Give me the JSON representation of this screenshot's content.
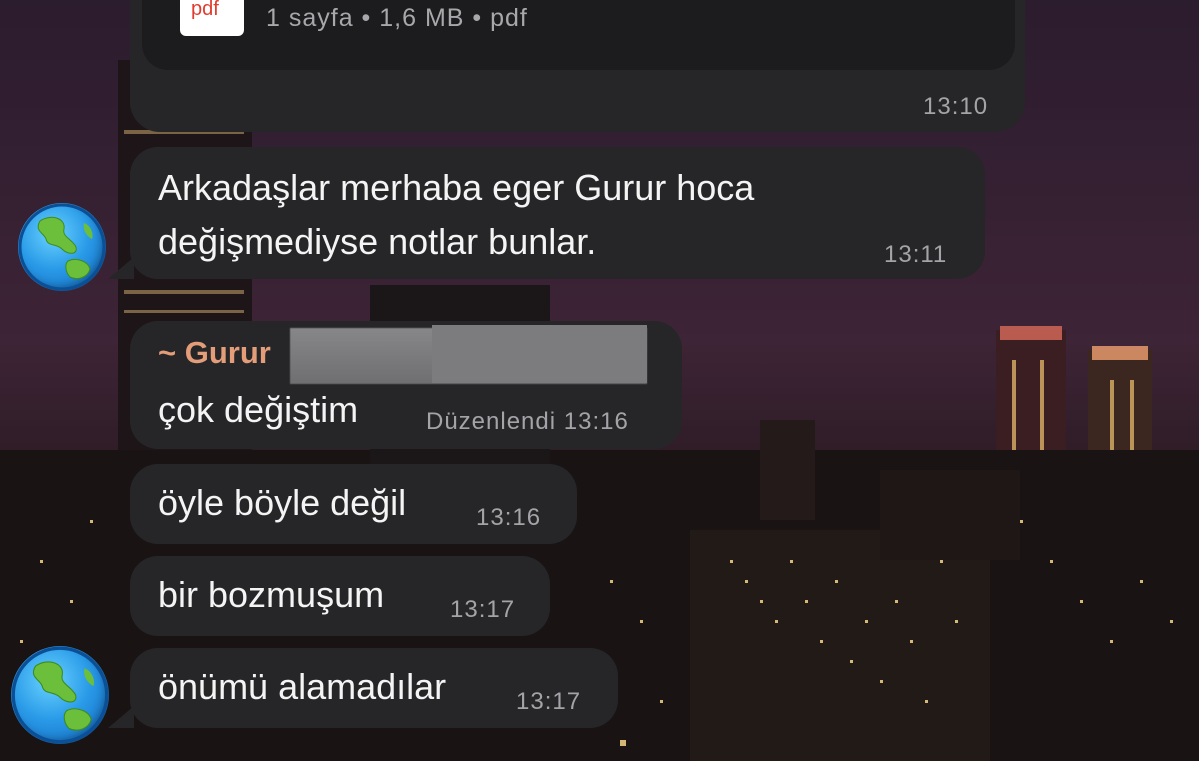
{
  "document": {
    "icon": "pdf-file-icon",
    "icon_label": "pdf",
    "meta": "1 sayfa • 1,6 MB • pdf",
    "time": "13:10"
  },
  "messages": [
    {
      "text_line1": "Arkadaşlar merhaba eger Gurur hoca",
      "text_line2": "değişmediyse notlar bunlar.",
      "time": "13:11"
    },
    {
      "sender": "~ Gurur",
      "text": "çok değiştim",
      "time": "Düzenlendi 13:16"
    },
    {
      "text": "öyle böyle değil",
      "time": "13:16"
    },
    {
      "text": "bir bozmuşum",
      "time": "13:17"
    },
    {
      "text": "önümü alamadılar",
      "time": "13:17"
    }
  ],
  "avatar_icon": "globe-icon",
  "colors": {
    "bubble": "#262628",
    "sender_name": "#e39d78",
    "timestamp": "#a4a4a8"
  }
}
